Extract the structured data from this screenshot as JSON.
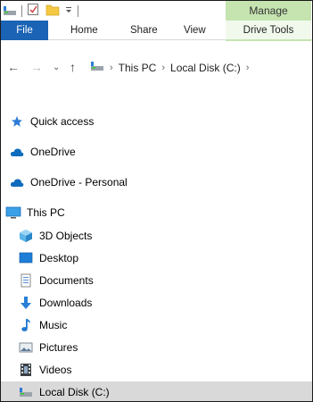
{
  "ribbon": {
    "contextual_group": "Manage",
    "tabs": {
      "file": "File",
      "home": "Home",
      "share": "Share",
      "view": "View",
      "drive_tools": "Drive Tools"
    }
  },
  "address_bar": {
    "crumbs": [
      "This PC",
      "Local Disk (C:)"
    ]
  },
  "nav_pane": {
    "quick_access": "Quick access",
    "onedrive": "OneDrive",
    "onedrive_personal": "OneDrive - Personal",
    "this_pc": "This PC",
    "objects_3d": "3D Objects",
    "desktop": "Desktop",
    "documents": "Documents",
    "downloads": "Downloads",
    "music": "Music",
    "pictures": "Pictures",
    "videos": "Videos",
    "local_disk": "Local Disk (C:)"
  },
  "colors": {
    "file_tab": "#1a63b5",
    "manage_tab": "#c5e4b0",
    "selection": "#d9d9d9",
    "onedrive": "#0f6cbd",
    "quick_access_star": "#2e7bd6"
  }
}
